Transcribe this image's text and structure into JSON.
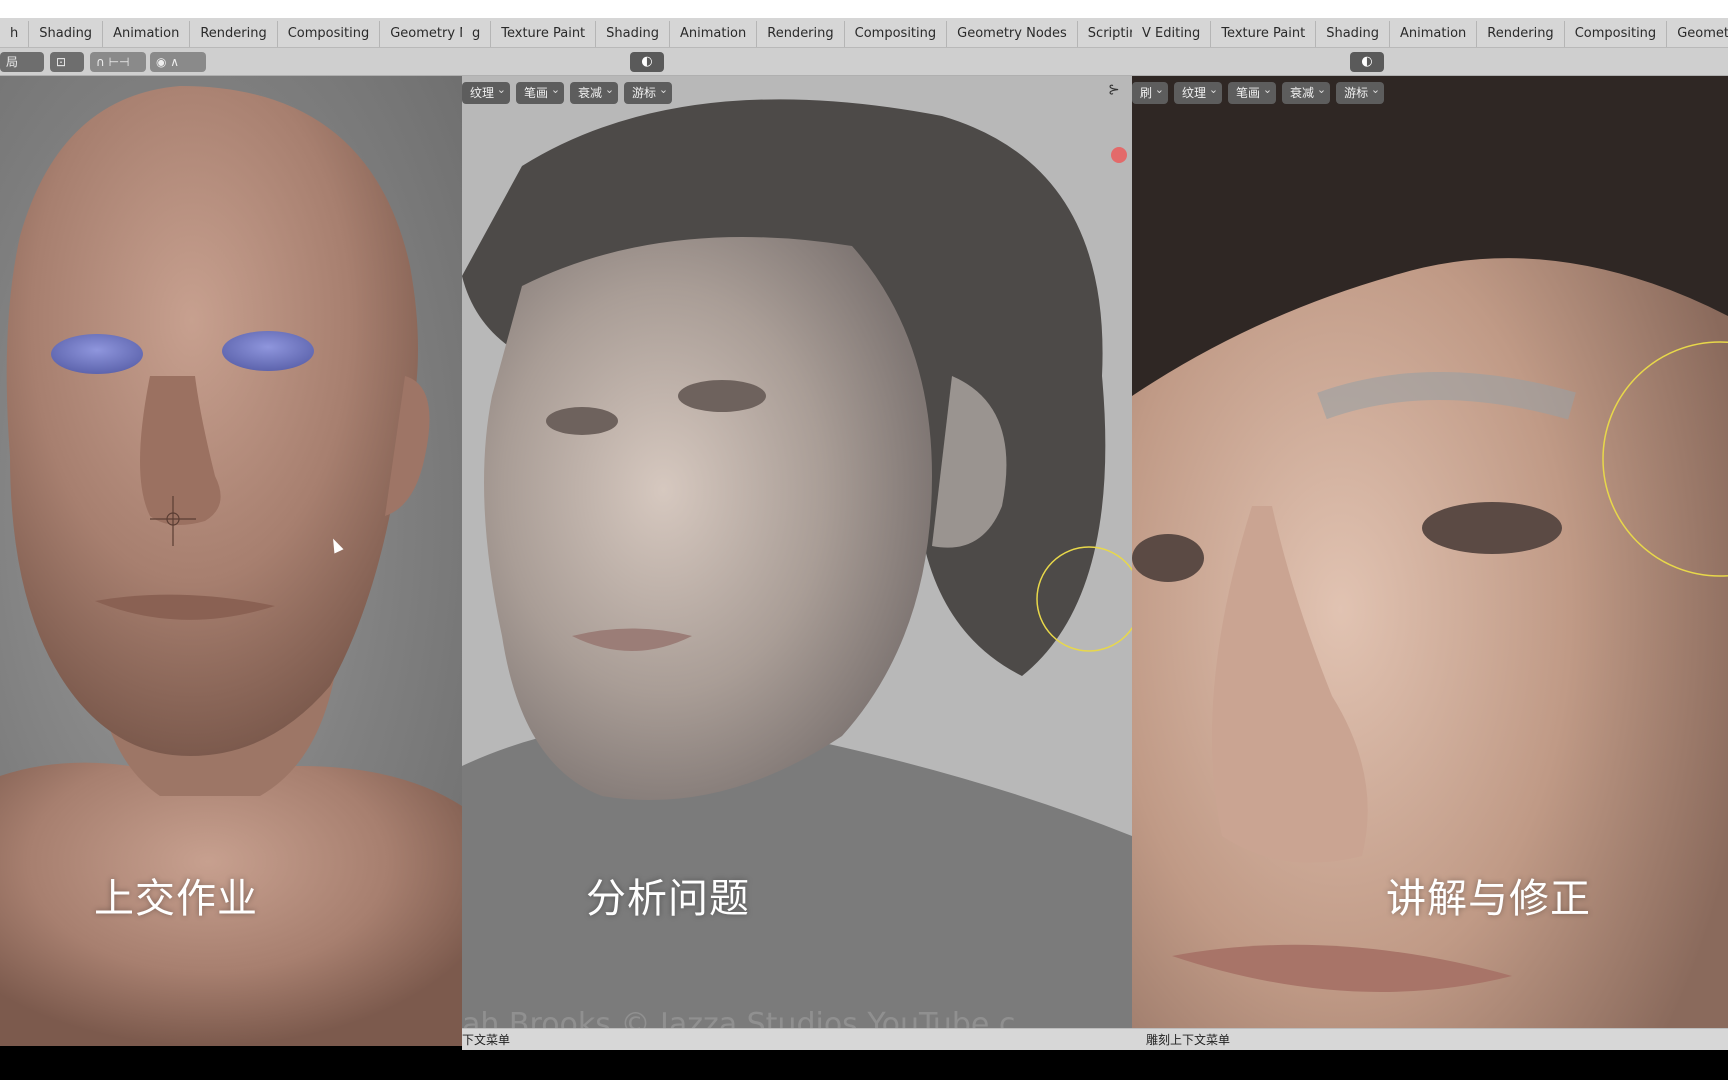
{
  "panels": {
    "left": {
      "tabs": [
        "h",
        "Shading",
        "Animation",
        "Rendering",
        "Compositing",
        "Geometry Nodes"
      ],
      "toolbar": {
        "mode_label": "局",
        "view_icon": "viewport-shading-icon"
      },
      "caption": "上交作业"
    },
    "middle": {
      "tabs": [
        "g",
        "Texture Paint",
        "Shading",
        "Animation",
        "Rendering",
        "Compositing",
        "Geometry Nodes",
        "Scripting",
        "+"
      ],
      "viewport_menus": [
        "纹理",
        "笔画",
        "衰减",
        "游标"
      ],
      "caption": "分析问题",
      "watermark": "ah Brooks   © Jazza Studios   YouTube.c",
      "status_text": "下文菜单"
    },
    "right": {
      "tabs": [
        "V Editing",
        "Texture Paint",
        "Shading",
        "Animation",
        "Rendering",
        "Compositing",
        "Geometry Node"
      ],
      "viewport_menus": [
        "刷",
        "纹理",
        "笔画",
        "衰减",
        "游标"
      ],
      "caption": "讲解与修正",
      "status_text": "雕刻上下文菜单"
    }
  },
  "colors": {
    "tabbar_bg": "#d6d6d6",
    "menu_bg": "#5d5d5d",
    "eye_blue": "#7b83c9",
    "brush_circle": "#e8d84a",
    "skin_clay": "#b08a7a"
  }
}
